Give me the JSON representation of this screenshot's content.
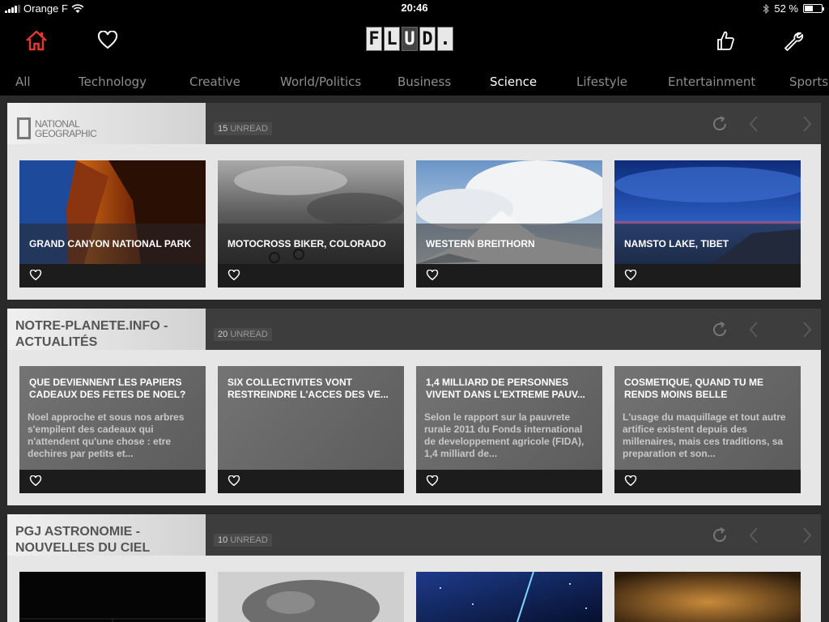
{
  "status": {
    "carrier": "Orange F",
    "time": "20:46",
    "battery": "52 %",
    "battery_level": 0.52
  },
  "toolbar": {
    "logo_letters": [
      "F",
      "L",
      "U",
      "D",
      "."
    ],
    "home_icon": "home-icon",
    "favorites_icon": "heart-icon",
    "like_icon": "thumbs-up-icon",
    "settings_icon": "wrench-icon",
    "home_color": "#e03a2e"
  },
  "tabs": [
    "All",
    "Technology",
    "Creative",
    "World/Politics",
    "Business",
    "Science",
    "Lifestyle",
    "Entertainment",
    "Sports"
  ],
  "active_tab": "Science",
  "sections": [
    {
      "title_line1": "NATIONAL",
      "title_line2": "GEOGRAPHIC",
      "unread_count": "15",
      "unread_label": "UNREAD",
      "cards": [
        {
          "caption": "GRAND CANYON NATIONAL PARK"
        },
        {
          "caption": "MOTOCROSS BIKER, COLORADO"
        },
        {
          "caption": "WESTERN BREITHORN"
        },
        {
          "caption": "NAMSTO LAKE, TIBET"
        }
      ]
    },
    {
      "title_line1": "NOTRE-PLANETE.INFO -",
      "title_line2": "ACTUALITÉS",
      "unread_count": "20",
      "unread_label": "UNREAD",
      "cards": [
        {
          "title": "QUE DEVIENNENT LES PAPIERS CADEAUX DES FETES DE NOEL?",
          "body": "Noel approche et sous nos arbres s'empilent des cadeaux qui n'attendent qu'une chose : etre dechires par petits et..."
        },
        {
          "title": "SIX COLLECTIVITES VONT RESTREINDRE L'ACCES DES VE...",
          "body": ""
        },
        {
          "title": "1,4 MILLIARD DE PERSONNES VIVENT DANS L'EXTREME PAUV...",
          "body": "Selon le rapport sur la pauvrete rurale 2011 du Fonds international de developpement agricole (FIDA), 1,4 milliard de..."
        },
        {
          "title": "COSMETIQUE, QUAND TU ME RENDS MOINS BELLE",
          "body": "L'usage du maquillage et tout autre artifice existent depuis des millenaires, mais ces traditions, sa preparation et son..."
        }
      ]
    },
    {
      "title_line1": "PGJ ASTRONOMIE -",
      "title_line2": "NOUVELLES DU CIEL",
      "unread_count": "10",
      "unread_label": "UNREAD"
    }
  ]
}
